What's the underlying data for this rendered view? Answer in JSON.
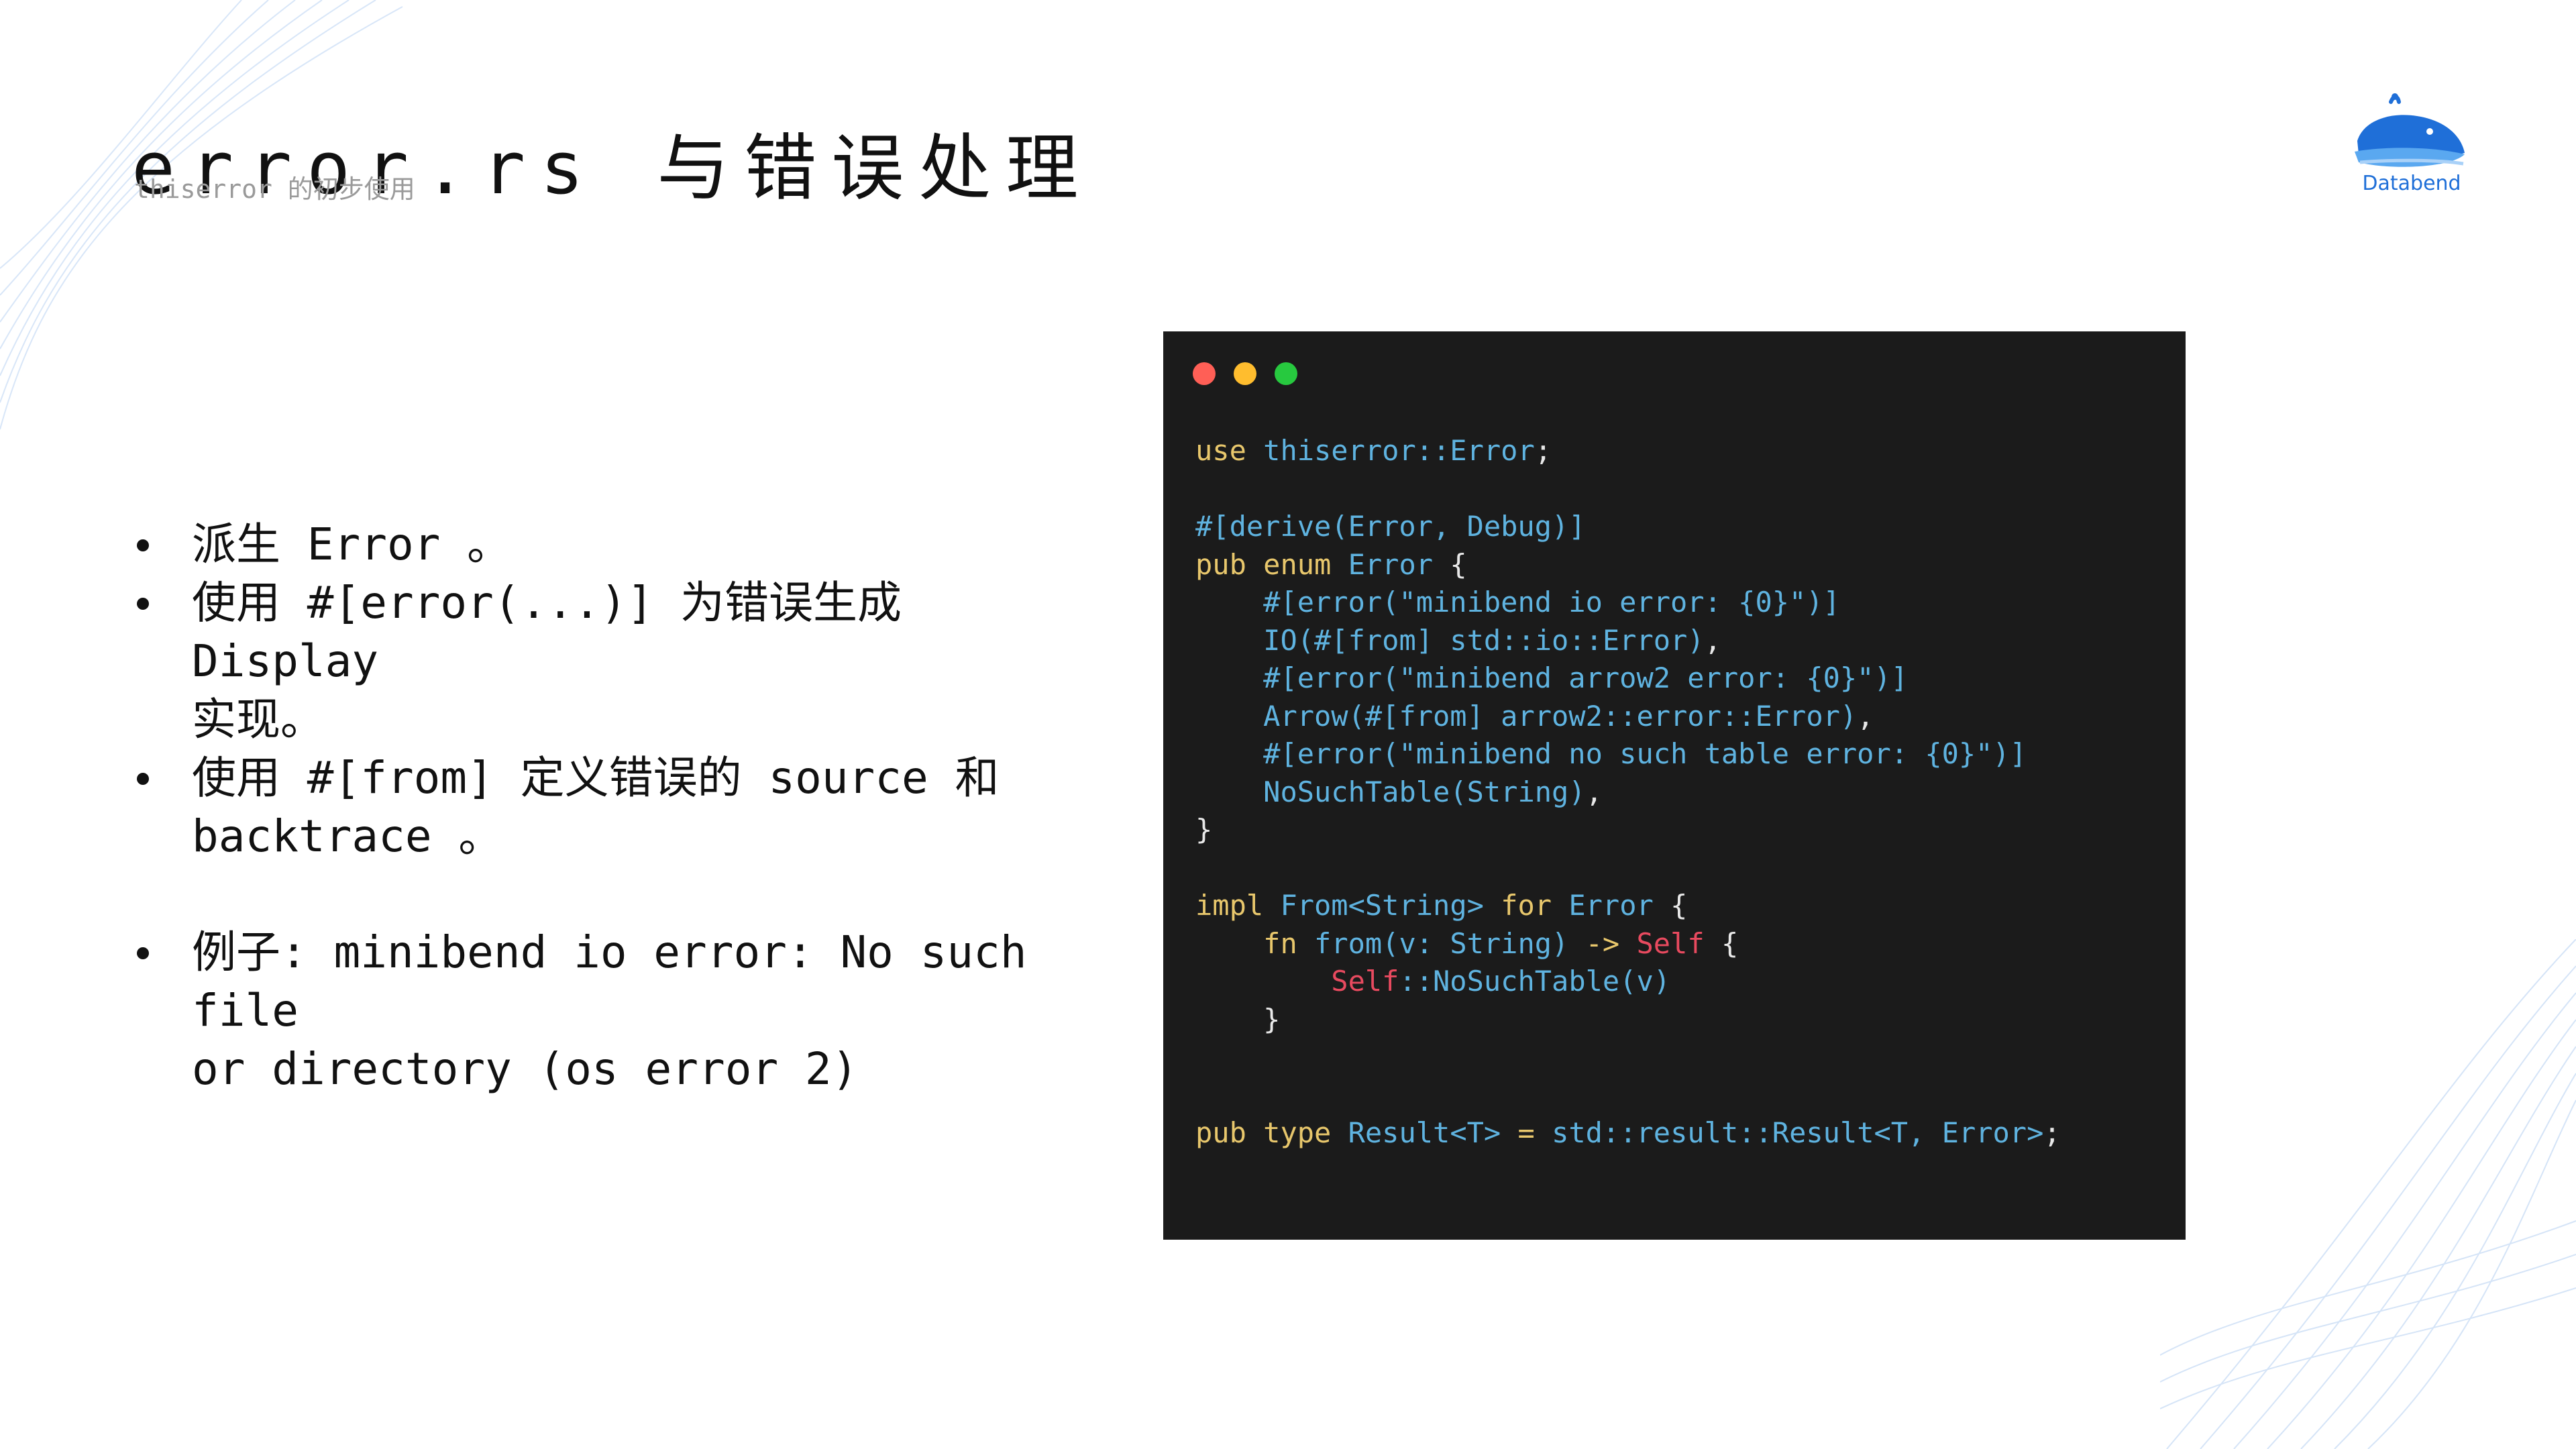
{
  "slide": {
    "title": "error.rs 与错误处理",
    "subtitle": "thiserror 的初步使用"
  },
  "logo": {
    "name": "Databend",
    "colors": {
      "primary": "#1f6fd8",
      "light": "#5aa8f0"
    }
  },
  "bullets": [
    {
      "line1": "派生 Error 。"
    },
    {
      "line1": "使用 #[error(...)] 为错误生成 Display",
      "line2": "实现。"
    },
    {
      "line1": "使用 #[from] 定义错误的 source 和",
      "line2": "backtrace 。"
    },
    {
      "line1": "例子: minibend io error: No such file",
      "line2": "or directory (os error 2)"
    }
  ],
  "code_window": {
    "colors": {
      "background": "#1b1b1b",
      "keyword": "#e8c76c",
      "type": "#5fb3e0",
      "self": "#e84a5f",
      "dot_red": "#ff5f56",
      "dot_yellow": "#ffbd2e",
      "dot_green": "#27c93f"
    },
    "tokens": {
      "use": "use",
      "thiserror_path": "thiserror::Error",
      "semi": ";",
      "derive_attr": "#[derive(Error, Debug)]",
      "pub": "pub",
      "enum": "enum",
      "error": "Error",
      "open_brace": "{",
      "close_brace": "}",
      "attr_io": "#[error(\"minibend io error: {0}\")]",
      "variant_io": "IO(#[from] std::io::Error)",
      "attr_arrow": "#[error(\"minibend arrow2 error: {0}\")]",
      "variant_arrow": "Arrow(#[from] arrow2::error::Error)",
      "attr_table": "#[error(\"minibend no such table error: {0}\")]",
      "variant_table": "NoSuchTable(String)",
      "comma": ",",
      "impl": "impl",
      "from_string": "From<String>",
      "for": "for",
      "fn": "fn",
      "from_sig": "from(v: String)",
      "arrow": "->",
      "self_type": "Self",
      "self_path": "Self",
      "nosuchtable_call": "::NoSuchTable(v)",
      "type": "type",
      "result_decl": "Result<T>",
      "equals": "=",
      "result_path": "std::result::Result<T, Error>"
    }
  }
}
